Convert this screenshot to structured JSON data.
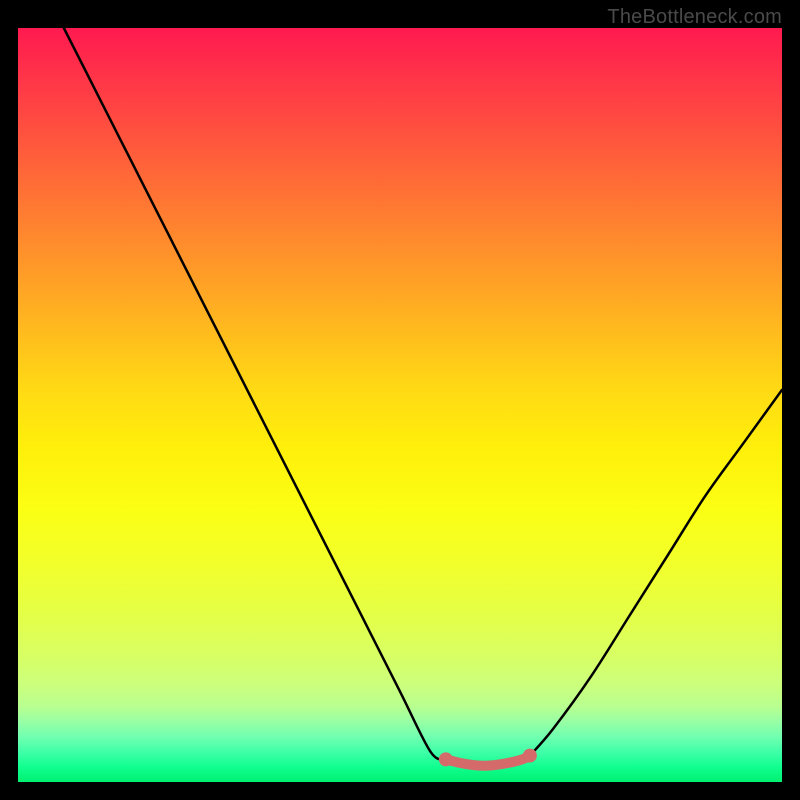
{
  "watermark": "TheBottleneck.com",
  "chart_data": {
    "type": "line",
    "title": "",
    "xlabel": "",
    "ylabel": "",
    "xlim": [
      0,
      100
    ],
    "ylim": [
      0,
      100
    ],
    "grid": false,
    "series": [
      {
        "name": "left-curve",
        "x": [
          6,
          10,
          15,
          20,
          25,
          30,
          35,
          40,
          45,
          50,
          54,
          56
        ],
        "y": [
          100,
          92,
          82,
          72,
          62,
          52,
          42,
          32,
          22,
          12,
          4,
          3
        ]
      },
      {
        "name": "bottom-plateau",
        "x": [
          56,
          58,
          60,
          62,
          64,
          66,
          67
        ],
        "y": [
          3,
          2.5,
          2.2,
          2.2,
          2.5,
          3,
          3.5
        ],
        "style": "thick-red"
      },
      {
        "name": "right-curve",
        "x": [
          67,
          70,
          75,
          80,
          85,
          90,
          95,
          100
        ],
        "y": [
          3.5,
          7,
          14,
          22,
          30,
          38,
          45,
          52
        ]
      }
    ],
    "colors": {
      "curve": "#000000",
      "plateau": "#d46a6a",
      "plateau_dot": "#d46a6a"
    }
  }
}
